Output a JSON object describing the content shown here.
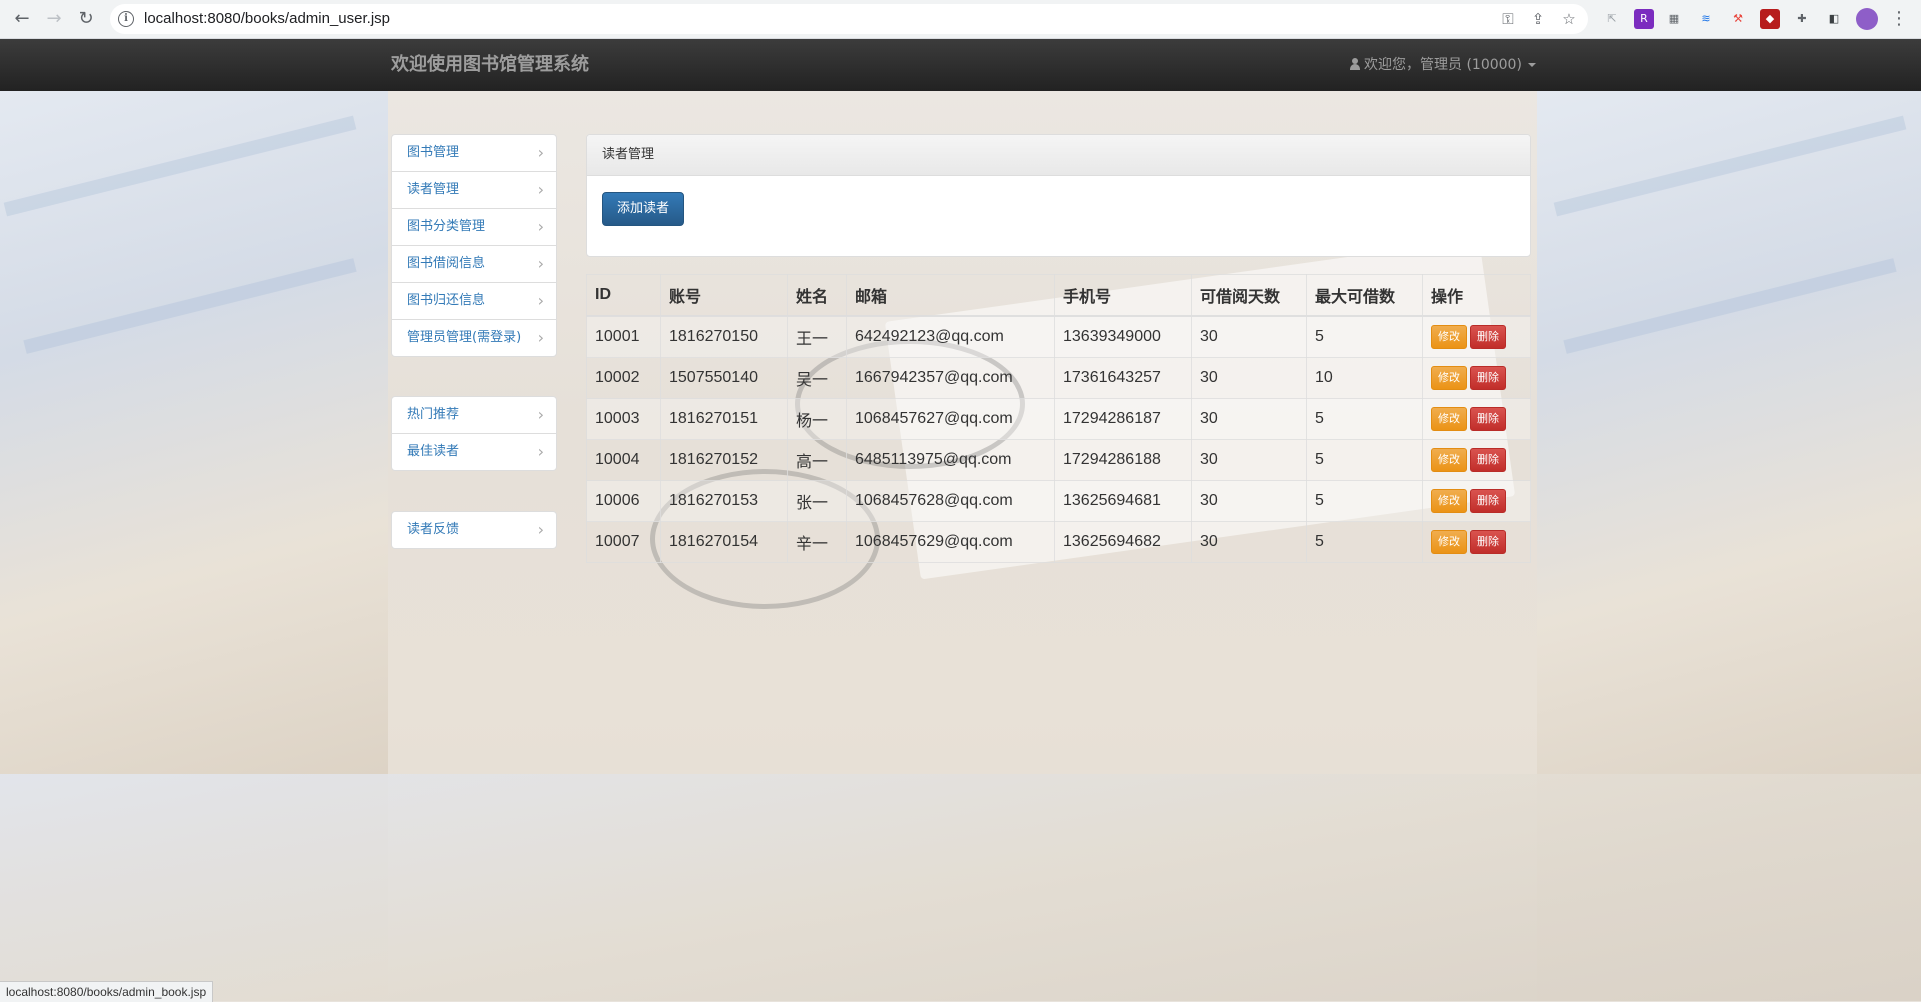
{
  "browser": {
    "url": "localhost:8080/books/admin_user.jsp",
    "status_url": "localhost:8080/books/admin_book.jsp"
  },
  "navbar": {
    "brand": "欢迎使用图书馆管理系统",
    "user_greeting": "欢迎您，管理员 (10000)"
  },
  "sidebar": {
    "group1": [
      {
        "label": "图书管理"
      },
      {
        "label": "读者管理"
      },
      {
        "label": "图书分类管理"
      },
      {
        "label": "图书借阅信息"
      },
      {
        "label": "图书归还信息"
      },
      {
        "label": "管理员管理(需登录)"
      }
    ],
    "group2": [
      {
        "label": "热门推荐"
      },
      {
        "label": "最佳读者"
      }
    ],
    "group3": [
      {
        "label": "读者反馈"
      }
    ]
  },
  "panel": {
    "title": "读者管理",
    "add_button": "添加读者"
  },
  "table": {
    "headers": [
      "ID",
      "账号",
      "姓名",
      "邮箱",
      "手机号",
      "可借阅天数",
      "最大可借数",
      "操作"
    ],
    "edit_label": "修改",
    "delete_label": "删除",
    "rows": [
      {
        "id": "10001",
        "account": "1816270150",
        "name": "王一",
        "email": "642492123@qq.com",
        "phone": "13639349000",
        "days": "30",
        "max": "5"
      },
      {
        "id": "10002",
        "account": "1507550140",
        "name": "吴一",
        "email": "1667942357@qq.com",
        "phone": "17361643257",
        "days": "30",
        "max": "10"
      },
      {
        "id": "10003",
        "account": "1816270151",
        "name": "杨一",
        "email": "1068457627@qq.com",
        "phone": "17294286187",
        "days": "30",
        "max": "5"
      },
      {
        "id": "10004",
        "account": "1816270152",
        "name": "高一",
        "email": "6485113975@qq.com",
        "phone": "17294286188",
        "days": "30",
        "max": "5"
      },
      {
        "id": "10006",
        "account": "1816270153",
        "name": "张一",
        "email": "1068457628@qq.com",
        "phone": "13625694681",
        "days": "30",
        "max": "5"
      },
      {
        "id": "10007",
        "account": "1816270154",
        "name": "辛一",
        "email": "1068457629@qq.com",
        "phone": "13625694682",
        "days": "30",
        "max": "5"
      }
    ]
  },
  "colors": {
    "navbar_bg": "#222222",
    "link": "#337ab7",
    "primary": "#337ab7",
    "warning": "#f0ad4e",
    "danger": "#d9534f"
  }
}
